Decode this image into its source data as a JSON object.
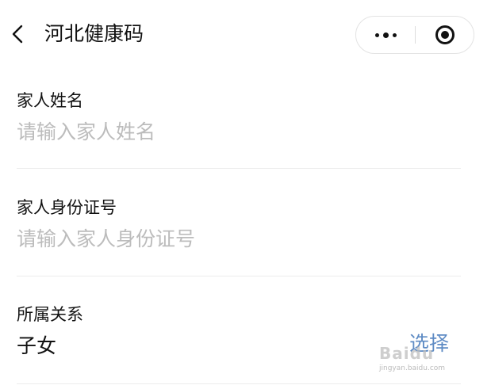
{
  "nav": {
    "title": "河北健康码"
  },
  "form": {
    "name_field": {
      "label": "家人姓名",
      "value": "",
      "placeholder": "请输入家人姓名"
    },
    "id_field": {
      "label": "家人身份证号",
      "value": "",
      "placeholder": "请输入家人身份证号"
    },
    "relation_field": {
      "label": "所属关系",
      "value": "子女",
      "action_label": "选择"
    }
  },
  "watermark": {
    "logo": "Baidu",
    "sub": "jingyan.baidu.com"
  },
  "colors": {
    "background": "#ffffff",
    "text": "#111111",
    "placeholder": "#bcbcbc",
    "link": "#5e8bc4",
    "divider": "#ececec"
  },
  "icons": {
    "back": "chevron-left-icon",
    "more": "more-dots-icon",
    "close": "target-close-icon"
  }
}
